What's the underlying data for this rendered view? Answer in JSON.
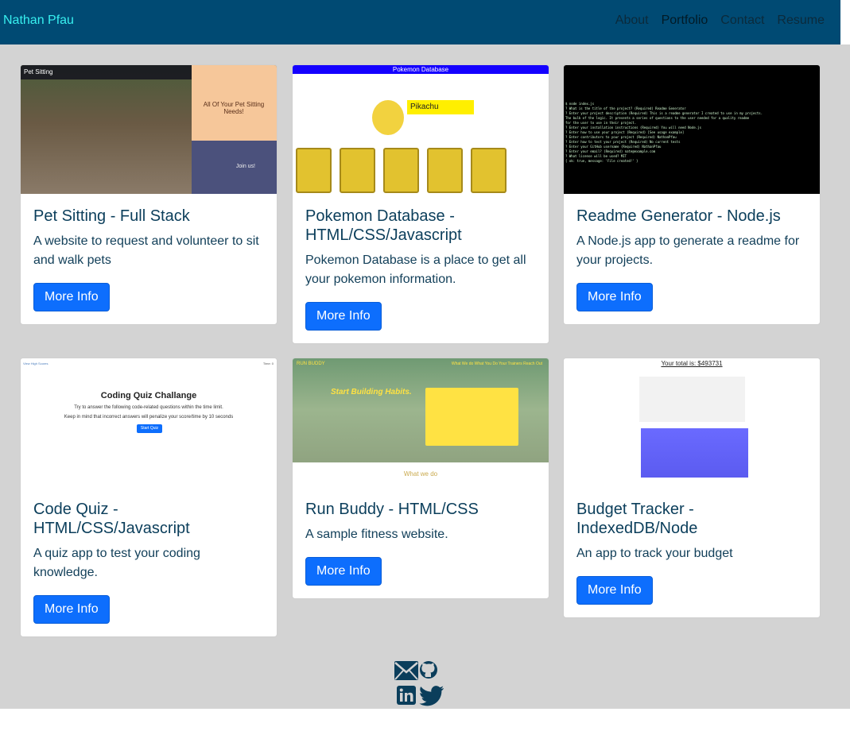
{
  "nav": {
    "brand": "Nathan Pfau",
    "links": [
      "About",
      "Portfolio",
      "Contact",
      "Resume"
    ],
    "active": "Portfolio"
  },
  "projects": [
    {
      "title": "Pet Sitting - Full Stack",
      "description": "A website to request and volunteer to sit and walk pets",
      "button": "More Info",
      "thumb": {
        "logo": "Pet Sitting",
        "heading": "All Of Your Pet Sitting Needs!",
        "cta": "Join us!"
      }
    },
    {
      "title": "Pokemon Database - HTML/CSS/Javascript",
      "description": "Pokemon Database is a place to get all your pokemon information.",
      "button": "More Info",
      "thumb": {
        "header": "Pokemon Database",
        "name": "Pikachu"
      }
    },
    {
      "title": "Readme Generator - Node.js",
      "description": "A Node.js app to generate a readme for your projects.",
      "button": "More Info",
      "thumb": {
        "lines": [
          "$ node index.js",
          "? What is the title of the project? (Required) Readme Generator",
          "? Enter your project description (Required) This is a readme generator I created to use in my projects.",
          "  The bulk of the logic. It presents a series of questions to the user needed for a quality readme",
          "  for the user to use in their project.",
          "? Enter your installation instructions (Required) You will need Node.js",
          "? Enter how to use your project (Required) [See usage example]",
          "? Enter contributors to your project (Required) NathanPfau",
          "? Enter how to test your project (Required) No current tests",
          "? Enter your GitHub username (Required) NathanPfau",
          "? Enter your email? (Required) nate@example.com",
          "? What license will be used? MIT",
          "{ ok: true, message: 'File created!' }"
        ]
      }
    },
    {
      "title": "Code Quiz - HTML/CSS/Javascript",
      "description": "A quiz app to test your coding knowledge.",
      "button": "More Info",
      "thumb": {
        "corner": "View High Scores",
        "timer": "Time: 0",
        "heading": "Coding Quiz Challange",
        "line1": "Try to answer the following code-related questions within the time limit.",
        "line2": "Keep in mind that incorrect answers will penalize your score/time by 10 seconds",
        "start": "Start Quiz"
      }
    },
    {
      "title": "Run Buddy - HTML/CSS",
      "description": "A sample fitness website.",
      "button": "More Info",
      "thumb": {
        "logo": "RUN BUDDY",
        "menu": "What We do   What You Do   Your Trainers   Reach Out",
        "heading": "Start Building Habits.",
        "section": "What we do"
      }
    },
    {
      "title": "Budget Tracker - IndexedDB/Node",
      "description": "An app to track your budget",
      "button": "More Info",
      "thumb": {
        "total": "Your total is: $493731"
      }
    }
  ],
  "footer": {
    "icons": [
      "envelope-icon",
      "github-icon",
      "linkedin-icon",
      "twitter-icon"
    ]
  },
  "colors": {
    "nav_bg": "#004a73",
    "brand": "#37f0f0",
    "main_bg": "#d3d3d3",
    "button": "#0d6efd",
    "title": "#0b3e5b",
    "icon": "#0b3e5b"
  }
}
